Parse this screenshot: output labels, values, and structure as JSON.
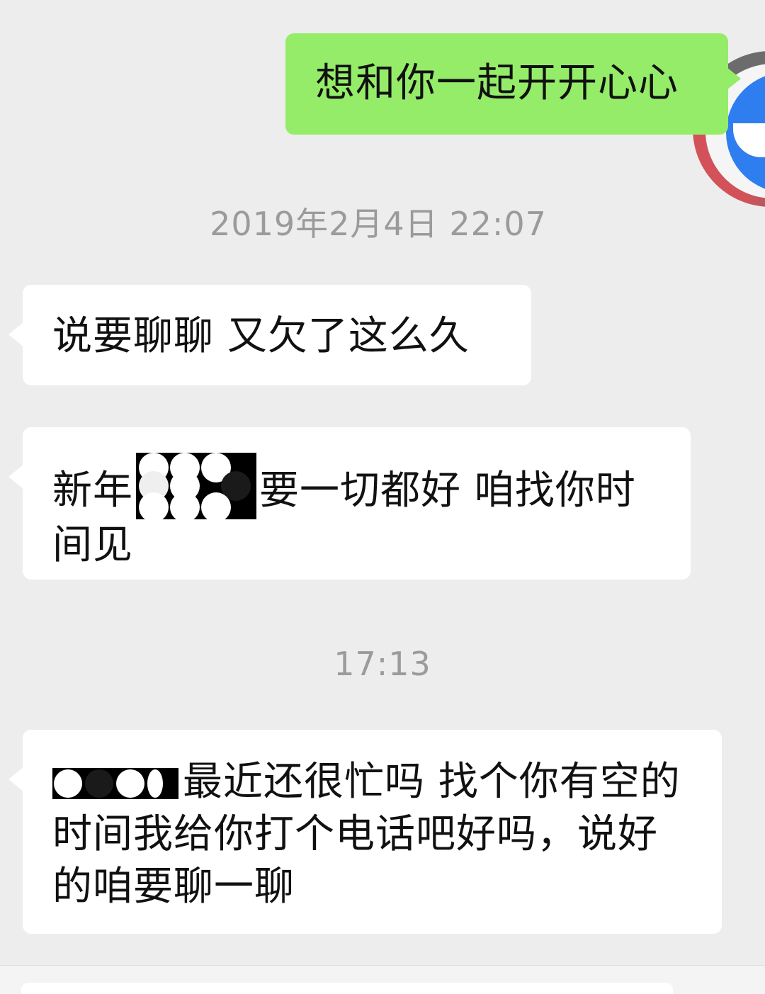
{
  "chat": {
    "outgoing_message": "想和你一起开开心心",
    "timestamp_1": "2019年2月4日 22:07",
    "message_1": "说要聊聊 又欠了这么久",
    "message_2_before": "新年",
    "message_2_after": "要一切都好 咱找你时间见",
    "timestamp_2": "17:13",
    "message_3_after": "最近还很忙吗 找个你有空的时间我给你打个电话吧好吗，说好的咱要聊一聊"
  },
  "colors": {
    "background": "#ededed",
    "outgoing_bubble": "#95ec69",
    "incoming_bubble": "#ffffff",
    "timestamp_text": "#9b9b9b"
  },
  "icons": {
    "avatar": "avatar-icon"
  }
}
